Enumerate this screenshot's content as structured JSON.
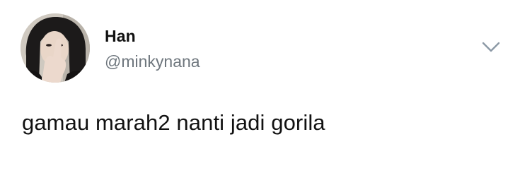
{
  "tweet": {
    "author": {
      "display_name": "Han",
      "handle": "@minkynana",
      "avatar_icon": "profile-photo"
    },
    "text": "gamau marah2 nanti jadi gorila",
    "menu_icon": "chevron-down-icon"
  },
  "colors": {
    "text_primary": "#111111",
    "text_secondary": "#6e767d",
    "chevron": "#8b98a5",
    "background": "#ffffff"
  }
}
